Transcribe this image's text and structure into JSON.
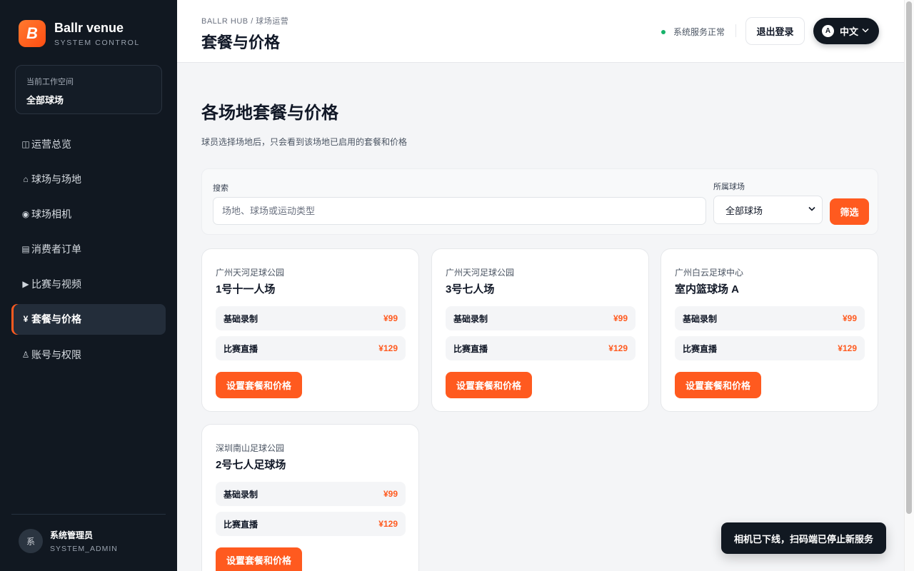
{
  "brand": {
    "name": "Ballr venue",
    "subtitle": "SYSTEM CONTROL",
    "logo_letter": "B"
  },
  "workspace": {
    "label": "当前工作空间",
    "value": "全部球场"
  },
  "nav": [
    {
      "icon": "◫",
      "icon_name": "overview-icon",
      "label": "运营总览",
      "active": false
    },
    {
      "icon": "⌂",
      "icon_name": "home-icon",
      "label": "球场与场地",
      "active": false
    },
    {
      "icon": "◉",
      "icon_name": "camera-icon",
      "label": "球场相机",
      "active": false
    },
    {
      "icon": "▤",
      "icon_name": "orders-icon",
      "label": "消费者订单",
      "active": false
    },
    {
      "icon": "▶",
      "icon_name": "play-icon",
      "label": "比赛与视频",
      "active": false
    },
    {
      "icon": "¥",
      "icon_name": "yen-icon",
      "label": "套餐与价格",
      "active": true
    },
    {
      "icon": "♙",
      "icon_name": "user-icon",
      "label": "账号与权限",
      "active": false
    }
  ],
  "user": {
    "avatar": "系",
    "name": "系统管理员",
    "role": "SYSTEM_ADMIN"
  },
  "header": {
    "breadcrumb": "BALLR HUB / 球场运营",
    "title": "套餐与价格",
    "status": "系统服务正常",
    "logout": "退出登录",
    "lang_badge": "A",
    "lang": "中文"
  },
  "section": {
    "title": "各场地套餐与价格",
    "description": "球员选择场地后，只会看到该场地已启用的套餐和价格"
  },
  "filter": {
    "search_label": "搜索",
    "search_placeholder": "场地、球场或运动类型",
    "search_value": "",
    "venue_label": "所属球场",
    "venue_value": "全部球场",
    "button": "筛选"
  },
  "cards": [
    {
      "venue": "广州天河足球公园",
      "name": "1号十一人场",
      "plans": [
        {
          "name": "基础录制",
          "price": "¥99"
        },
        {
          "name": "比赛直播",
          "price": "¥129"
        }
      ],
      "button": "设置套餐和价格"
    },
    {
      "venue": "广州天河足球公园",
      "name": "3号七人场",
      "plans": [
        {
          "name": "基础录制",
          "price": "¥99"
        },
        {
          "name": "比赛直播",
          "price": "¥129"
        }
      ],
      "button": "设置套餐和价格"
    },
    {
      "venue": "广州白云足球中心",
      "name": "室内篮球场 A",
      "plans": [
        {
          "name": "基础录制",
          "price": "¥99"
        },
        {
          "name": "比赛直播",
          "price": "¥129"
        }
      ],
      "button": "设置套餐和价格"
    },
    {
      "venue": "深圳南山足球公园",
      "name": "2号七人足球场",
      "plans": [
        {
          "name": "基础录制",
          "price": "¥99"
        },
        {
          "name": "比赛直播",
          "price": "¥129"
        }
      ],
      "button": "设置套餐和价格"
    }
  ],
  "toast": "相机已下线，扫码端已停止新服务",
  "colors": {
    "accent": "#ff5a1f",
    "sidebar": "#111821",
    "status_ok": "#17b26a"
  }
}
